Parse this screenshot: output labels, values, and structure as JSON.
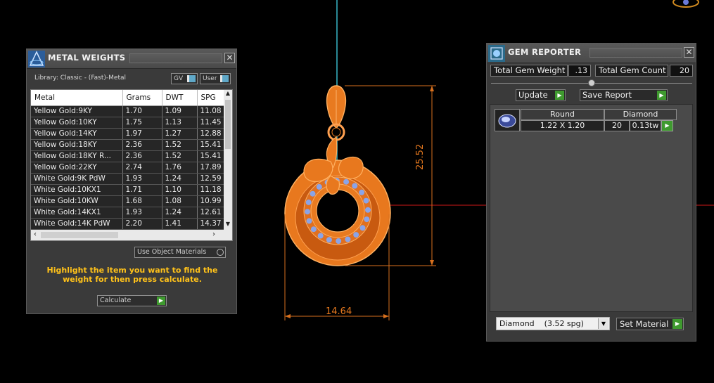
{
  "metal_panel": {
    "title": "METAL WEIGHTS",
    "close": "✕",
    "library_label": "Library: Classic - (Fast)-Metal",
    "gv_label": "GV",
    "user_label": "User",
    "columns": [
      "Metal",
      "Grams",
      "DWT",
      "SPG"
    ],
    "rows": [
      [
        "Yellow Gold:9KY",
        "1.70",
        "1.09",
        "11.08"
      ],
      [
        "Yellow Gold:10KY",
        "1.75",
        "1.13",
        "11.45"
      ],
      [
        "Yellow Gold:14KY",
        "1.97",
        "1.27",
        "12.88"
      ],
      [
        "Yellow Gold:18KY",
        "2.36",
        "1.52",
        "15.41"
      ],
      [
        "Yellow Gold:18KY R...",
        "2.36",
        "1.52",
        "15.41"
      ],
      [
        "Yellow Gold:22KY",
        "2.74",
        "1.76",
        "17.89"
      ],
      [
        "White Gold:9K PdW",
        "1.93",
        "1.24",
        "12.59"
      ],
      [
        "White Gold:10KX1",
        "1.71",
        "1.10",
        "11.18"
      ],
      [
        "White Gold:10KW",
        "1.68",
        "1.08",
        "10.99"
      ],
      [
        "White Gold:14KX1",
        "1.93",
        "1.24",
        "12.61"
      ],
      [
        "White Gold:14K PdW",
        "2.20",
        "1.41",
        "14.37"
      ]
    ],
    "use_object_materials": "Use Object Materials",
    "hint": "Highlight the item you want to find the weight for then press calculate.",
    "calculate_label": "Calculate"
  },
  "gem_panel": {
    "title": "GEM REPORTER",
    "close": "✕",
    "total_weight_label": "Total Gem Weight",
    "total_weight_value": ".13",
    "total_count_label": "Total Gem Count",
    "total_count_value": "20",
    "update_label": "Update",
    "save_label": "Save Report",
    "gem": {
      "shape": "Round",
      "material": "Diamond",
      "size": "1.22 X 1.20",
      "count": "20",
      "weight": "0.13tw"
    },
    "material_select": "Diamond    (3.52 spg)",
    "set_material_label": "Set Material"
  },
  "viewport": {
    "dim_height": "25.52",
    "dim_width": "14.64",
    "accent_color": "#e5781e",
    "gem_color": "#8aa4e8",
    "axis_red": "#8a1010",
    "axis_teal": "#2a8a96"
  }
}
